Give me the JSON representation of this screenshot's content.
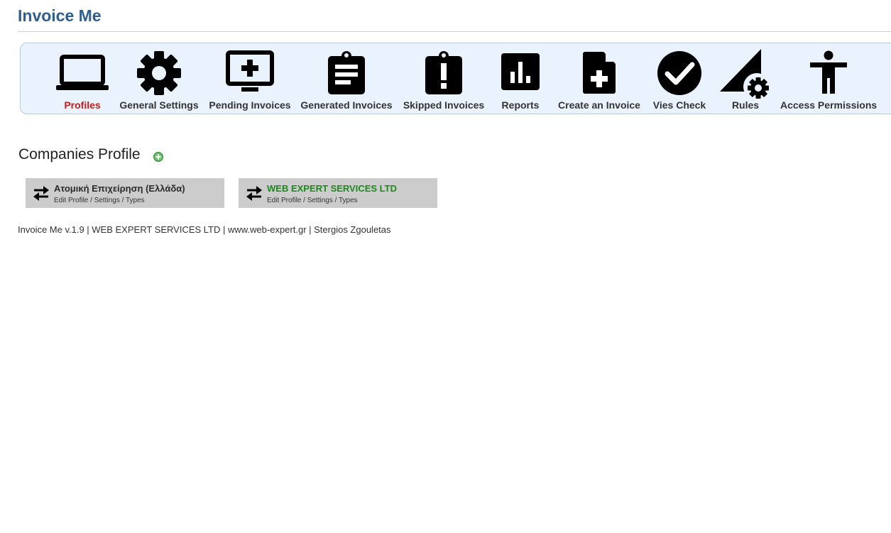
{
  "app": {
    "title": "Invoice Me"
  },
  "colors": {
    "title": "#2f5f8e",
    "toolbar_bg": "#eaf3fd",
    "active_label": "#cc1b1b",
    "card_bg": "#cccccc",
    "highlight_company": "#1a8a1a"
  },
  "toolbar": {
    "items": [
      {
        "label": "Profiles",
        "icon": "laptop-icon",
        "active": true
      },
      {
        "label": "General Settings",
        "icon": "gear-icon",
        "active": false
      },
      {
        "label": "Pending Invoices",
        "icon": "monitor-plus-icon",
        "active": false
      },
      {
        "label": "Generated Invoices",
        "icon": "clipboard-list-icon",
        "active": false
      },
      {
        "label": "Skipped Invoices",
        "icon": "clipboard-alert-icon",
        "active": false
      },
      {
        "label": "Reports",
        "icon": "bar-chart-icon",
        "active": false
      },
      {
        "label": "Create an Invoice",
        "icon": "file-plus-icon",
        "active": false
      },
      {
        "label": "Vies Check",
        "icon": "check-circle-icon",
        "active": false
      },
      {
        "label": "Rules",
        "icon": "ruler-gear-icon",
        "active": false
      },
      {
        "label": "Access Permissions",
        "icon": "person-icon",
        "active": false
      }
    ]
  },
  "companies": {
    "title": "Companies Profile",
    "add_icon": "add-circle-icon",
    "items": [
      {
        "name": "Ατομική Επιχείρηση (Ελλάδα)",
        "subtitle": "Edit Profile / Settings / Types",
        "highlight": false
      },
      {
        "name": "WEB EXPERT SERVICES LTD",
        "subtitle": "Edit Profile / Settings / Types",
        "highlight": true
      }
    ]
  },
  "footer": {
    "text": "Invoice Me v.1.9 | WEB EXPERT SERVICES LTD | www.web-expert.gr | Stergios Zgouletas"
  }
}
